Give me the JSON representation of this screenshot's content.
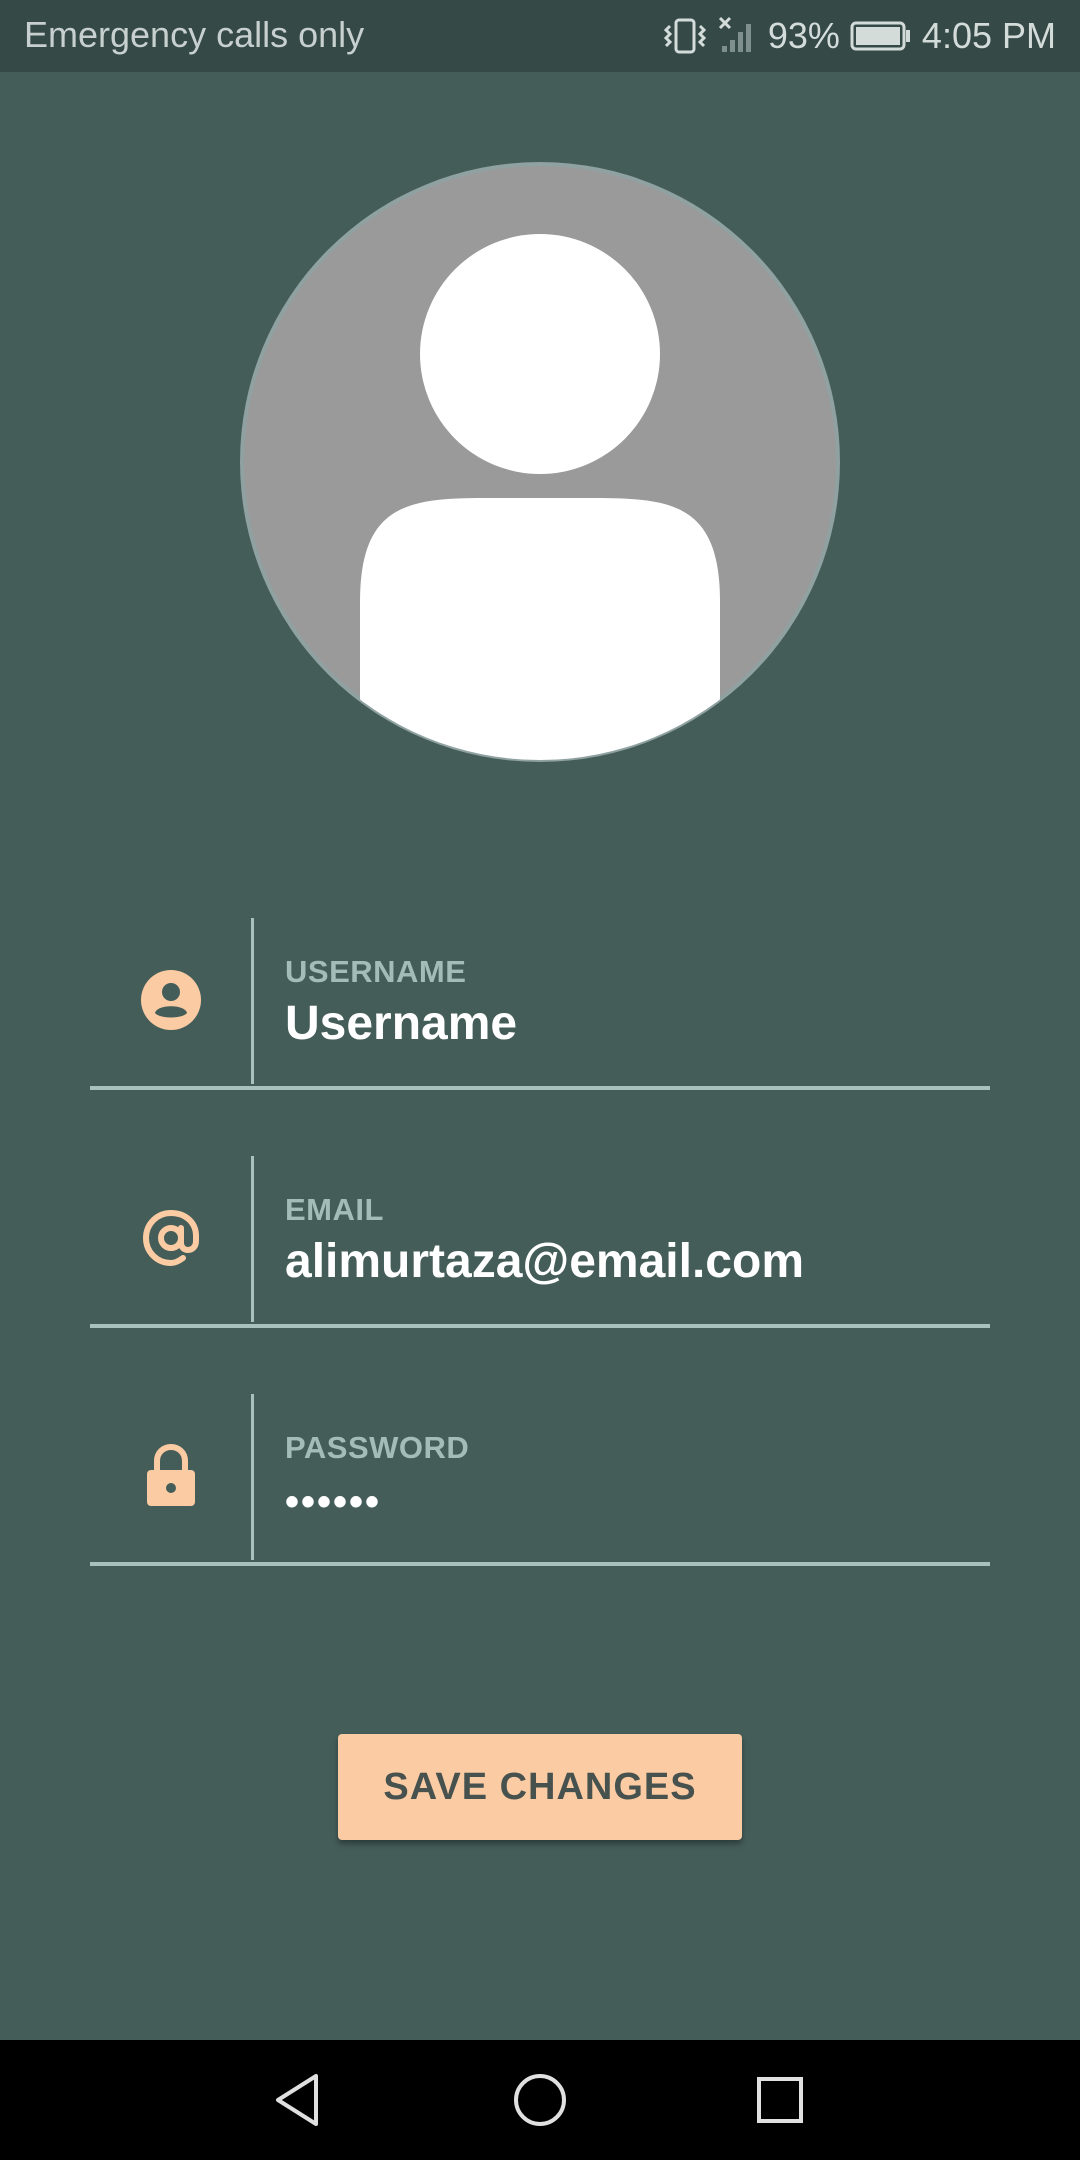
{
  "status_bar": {
    "carrier_text": "Emergency calls only",
    "battery_percent": "93%",
    "time": "4:05 PM",
    "icons": [
      "vibrate-icon",
      "no-signal-icon",
      "battery-icon"
    ]
  },
  "profile": {
    "avatar_icon": "default-user-avatar"
  },
  "form": {
    "username": {
      "label": "USERNAME",
      "value": "Username",
      "icon": "account-circle-icon"
    },
    "email": {
      "label": "EMAIL",
      "value": "alimurtaza@email.com",
      "icon": "at-sign-icon"
    },
    "password": {
      "label": "PASSWORD",
      "value": "••••••",
      "icon": "lock-icon"
    }
  },
  "actions": {
    "save_label": "SAVE CHANGES"
  },
  "nav_bar": {
    "icons": [
      "back-icon",
      "home-icon",
      "recents-icon"
    ]
  },
  "colors": {
    "background": "#445d59",
    "status_bar": "#354946",
    "accent": "#fbcba3",
    "field_line": "#a9c1bd",
    "label": "#a3bcb8"
  }
}
